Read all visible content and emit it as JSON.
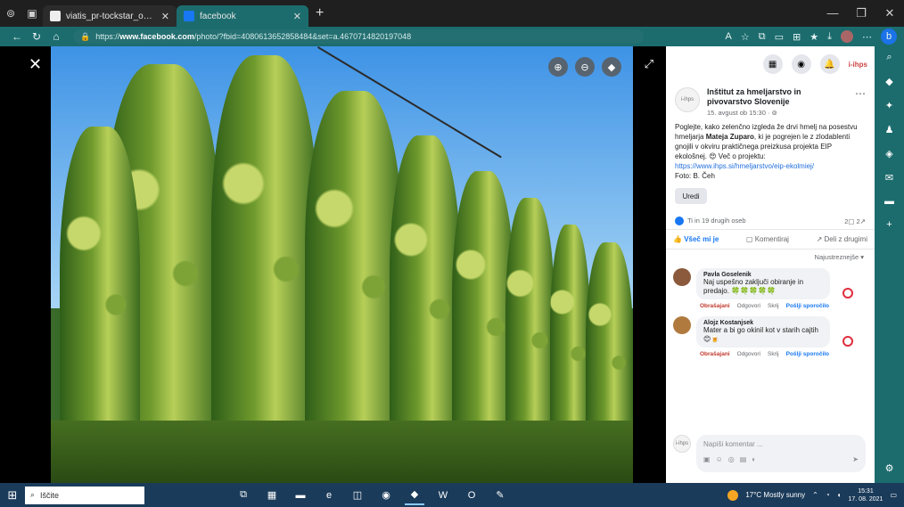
{
  "browser": {
    "tabs": [
      {
        "title": "viatis_pr-tockstar_o_skokodaro - xr",
        "active": false
      },
      {
        "title": "facebook",
        "active": true
      }
    ],
    "new_tab": "+",
    "url_prefix": "https://",
    "url_domain": "www.facebook.com",
    "url_rest": "/photo/?fbid=4080613652858484&set=a.4670714820197048"
  },
  "viewer": {
    "close_icon": "close-icon",
    "logo": "f",
    "tools": [
      "zoom-in-icon",
      "zoom-out-icon",
      "tag-icon"
    ]
  },
  "pane": {
    "page_avatar_text": "i-ihps",
    "page_name": "Inštitut za hmeljarstvo in pivovarstvo Slovenije",
    "post_date": "15. avgust ob 15:30 · ",
    "post_text_1": "Poglejte, kako zelenčno izgleda že drvi hmelj na posestvu hmeljarja ",
    "post_strong": "Mateja Zuparo",
    "post_text_2": ", ki je pogrejen le z zlodablenti gnojili v okviru praktičnega preizkusa projekta EIP ekološnej. 😍 Več o projektu: ",
    "post_link": "https://www.ihps.si/hmeljarstvo/eip-ekolmiej/",
    "post_credit": "Foto: B. Čeh",
    "edit_label": "Uredi",
    "reactions_text": "Ti in 19 drugih oseb",
    "comments_count": "2",
    "shares_count": "2",
    "like_label": "Všeč mi je",
    "comment_label": "Komentiraj",
    "share_label": "Deli z drugimi",
    "sort_label": "Najustreznejše ▾",
    "comments": [
      {
        "name": "Pavla Goselenik",
        "text": "Naj uspešno zaključi obiranje in predajo. 🍀🍀🍀🍀🍀",
        "actions": [
          "Obrašajani",
          "Odgovori",
          "Skrij",
          "Pošlji sporočilo"
        ],
        "avatar_color": "#8b5a3c"
      },
      {
        "name": "Alojz Kostanjsek",
        "text": "Mater a bi go okinil kot v starih cajtih 😊🍺",
        "actions": [
          "Obrašajani",
          "Odgovori",
          "Skrij",
          "Pošlji sporočilo"
        ],
        "avatar_color": "#b07a3e"
      }
    ],
    "composer_placeholder": "Napiši komentar ..."
  },
  "taskbar": {
    "search_placeholder": "Iščite",
    "weather": "17°C  Mostly sunny",
    "time": "15:31",
    "date": "17. 08. 2021"
  },
  "colors": {
    "edge_teal": "#1c6c6e",
    "facebook_blue": "#1877f2",
    "taskbar": "#1b3b5a"
  }
}
